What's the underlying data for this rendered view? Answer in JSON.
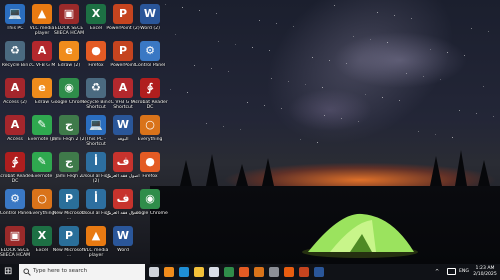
{
  "desktop": {
    "icons": [
      {
        "label": "This PC",
        "glyph": "💻",
        "bg": "#2a6dbf"
      },
      {
        "label": "VLC media player",
        "glyph": "▲",
        "bg": "#e87a12"
      },
      {
        "label": "ELOCK SECE SIIECA HCAM",
        "glyph": "▣",
        "bg": "#9a2a2a"
      },
      {
        "label": "Excel",
        "glyph": "X",
        "bg": "#1d7044"
      },
      {
        "label": "PowerPoint (2)",
        "glyph": "P",
        "bg": "#c5441f"
      },
      {
        "label": "Word (2)",
        "glyph": "W",
        "bg": "#2a5699"
      },
      {
        "label": "Recycle Bin",
        "glyph": "♻",
        "bg": "#4b6a80"
      },
      {
        "label": "cC VFB G M",
        "glyph": "A",
        "bg": "#b3282d"
      },
      {
        "label": "Edraw (2)",
        "glyph": "e",
        "bg": "#f08c1c"
      },
      {
        "label": "Firefox",
        "glyph": "●",
        "bg": "#e35b24"
      },
      {
        "label": "PowerPoint",
        "glyph": "P",
        "bg": "#c5441f"
      },
      {
        "label": "Control Panel",
        "glyph": "⚙",
        "bg": "#3a78c4"
      },
      {
        "label": "Access (2)",
        "glyph": "A",
        "bg": "#a4262c"
      },
      {
        "label": "Edraw",
        "glyph": "e",
        "bg": "#f08c1c"
      },
      {
        "label": "Google Chrome",
        "glyph": "◉",
        "bg": "#2f8d4a"
      },
      {
        "label": "Recycle Bin - Shortcut",
        "glyph": "♻",
        "bg": "#4b6a80"
      },
      {
        "label": "cC VFB G M - Shortcut",
        "glyph": "A",
        "bg": "#b3282d"
      },
      {
        "label": "Acrobat Reader DC",
        "glyph": "∳",
        "bg": "#b01e1e"
      },
      {
        "label": "Access",
        "glyph": "A",
        "bg": "#a4262c"
      },
      {
        "label": "Evernote (2)",
        "glyph": "✎",
        "bg": "#2fa84f"
      },
      {
        "label": "Jami Feqh 2 (2)",
        "glyph": "ج",
        "bg": "#3f7a4a"
      },
      {
        "label": "This PC - Shortcut",
        "glyph": "💻",
        "bg": "#2a6dbf"
      },
      {
        "label": "البوفه",
        "glyph": "W",
        "bg": "#2a5699"
      },
      {
        "label": "Everything",
        "glyph": "○",
        "bg": "#d9731a"
      },
      {
        "label": "Acrobat Reader DC",
        "glyph": "∳",
        "bg": "#b01e1e"
      },
      {
        "label": "Evernote",
        "glyph": "✎",
        "bg": "#2fa84f"
      },
      {
        "label": "Jami Feqh 2",
        "glyph": "ج",
        "bg": "#3f7a4a"
      },
      {
        "label": "Usoul al Fiqh (2)",
        "glyph": "أ",
        "bg": "#2d6fa0"
      },
      {
        "label": "اصول فقه العربي",
        "glyph": "ف",
        "bg": "#c7332d"
      },
      {
        "label": "Firefox",
        "glyph": "●",
        "bg": "#e35b24"
      },
      {
        "label": "Control Panel",
        "glyph": "⚙",
        "bg": "#3a78c4"
      },
      {
        "label": "Everything",
        "glyph": "○",
        "bg": "#d9731a"
      },
      {
        "label": "New Microsoft ...",
        "glyph": "P",
        "bg": "#2a6f9a"
      },
      {
        "label": "Usoul al Fiqh",
        "glyph": "أ",
        "bg": "#2d6fa0"
      },
      {
        "label": "اصول فقه العربي",
        "glyph": "ف",
        "bg": "#c7332d"
      },
      {
        "label": "Google Chrome",
        "glyph": "◉",
        "bg": "#2f8d4a"
      },
      {
        "label": "ELOCK SECE SIIECA HCAM",
        "glyph": "▣",
        "bg": "#9a2a2a"
      },
      {
        "label": "Excel",
        "glyph": "X",
        "bg": "#1d7044"
      },
      {
        "label": "New Microsoft ...",
        "glyph": "P",
        "bg": "#2a6f9a"
      },
      {
        "label": "VLC media player",
        "glyph": "▲",
        "bg": "#e87a12"
      },
      {
        "label": "Word",
        "glyph": "W",
        "bg": "#2a5699"
      }
    ]
  },
  "taskbar": {
    "start_glyph": "⊞",
    "search_placeholder": "Type here to search",
    "pinned": [
      {
        "name": "task-view-icon",
        "color": "#cfd3da"
      },
      {
        "name": "edraw-icon",
        "color": "#f08c1c"
      },
      {
        "name": "edge-icon",
        "color": "#1f8fd6"
      },
      {
        "name": "file-explorer-icon",
        "color": "#f3c13a"
      },
      {
        "name": "store-icon",
        "color": "#d8dde6"
      },
      {
        "name": "chrome-icon",
        "color": "#2f8d4a"
      },
      {
        "name": "firefox-icon",
        "color": "#e35b24"
      },
      {
        "name": "everything-icon",
        "color": "#d9731a"
      },
      {
        "name": "calculator-icon",
        "color": "#8c8f96"
      },
      {
        "name": "search-everything-icon",
        "color": "#e85d10"
      },
      {
        "name": "powerpoint-icon",
        "color": "#c5441f"
      },
      {
        "name": "word-icon",
        "color": "#2a5699"
      }
    ],
    "tray": {
      "language": "ENG",
      "time": "1:23 AM",
      "date": "2/10/2025"
    }
  },
  "colors": {
    "taskbar_bg": "#101217",
    "tent_green": "#8fe05a"
  }
}
